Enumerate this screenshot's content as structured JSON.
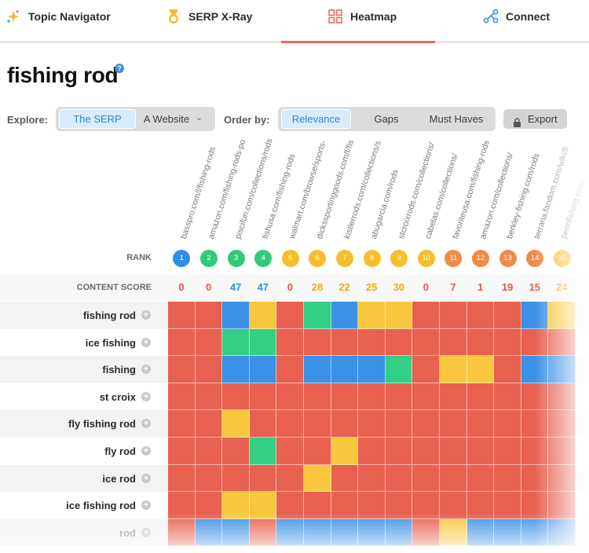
{
  "nav": {
    "tabs": [
      {
        "label": "Topic Navigator",
        "icon": "sparkle-icon"
      },
      {
        "label": "SERP X-Ray",
        "icon": "medal-icon"
      },
      {
        "label": "Heatmap",
        "icon": "grid-icon",
        "active": true
      },
      {
        "label": "Connect",
        "icon": "network-icon"
      }
    ]
  },
  "page": {
    "title": "fishing rod",
    "help_icon": "?"
  },
  "controls": {
    "explore_label": "Explore:",
    "explore_options": [
      "The SERP",
      "A Website"
    ],
    "explore_selected": "The SERP",
    "order_label": "Order by:",
    "order_options": [
      "Relevance",
      "Gaps",
      "Must Haves"
    ],
    "order_selected": "Relevance",
    "export_label": "Export"
  },
  "table": {
    "urls": [
      "basspro.com/l/fishing-rods",
      "amazon.com/fishing-rods-po",
      "piscifun.com/collections/rods",
      "fishusa.com/fishing-rods",
      "walmart.com/browse/sports-",
      "dickssportinggoods.com/f/fis",
      "kistlerrods.com/collections/s",
      "abugarcia.com/rods",
      "stcroixrods.com/collections/",
      "cabelas.com/collections/",
      "favoriteusa.com/fishing-rods",
      "amazon.com/collections/",
      "berkley-fishing.com/rods",
      "terraria.fandom.com/wiki/fi",
      "pennfishing.com"
    ],
    "rank_label": "RANK",
    "ranks": [
      "1",
      "2",
      "3",
      "4",
      "5",
      "6",
      "7",
      "8",
      "9",
      "10",
      "11",
      "12",
      "13",
      "14",
      "15"
    ],
    "rank_colors": [
      "#2e8fe4",
      "#2fca79",
      "#2fca79",
      "#2fca79",
      "#f6be2b",
      "#f6be2b",
      "#f6be2b",
      "#f6be2b",
      "#f6be2b",
      "#f6be2b",
      "#ef8a48",
      "#ef8a48",
      "#ef8a48",
      "#ef8a48",
      "#f6be2b"
    ],
    "score_label": "CONTENT SCORE",
    "scores": [
      "0",
      "0",
      "47",
      "47",
      "0",
      "28",
      "22",
      "25",
      "30",
      "0",
      "7",
      "1",
      "19",
      "15",
      "24"
    ],
    "score_colors": [
      "#e8574a",
      "#e8574a",
      "#2e8fe4",
      "#2e8fe4",
      "#e8574a",
      "#e9ad17",
      "#e9ad17",
      "#e9ad17",
      "#e9ad17",
      "#e8574a",
      "#e8574a",
      "#e8574a",
      "#e8574a",
      "#e8574a",
      "#e9ad17"
    ],
    "keywords": [
      "fishing rod",
      "ice fishing",
      "fishing",
      "st croix",
      "fly fishing rod",
      "fly rod",
      "ice rod",
      "ice fishing rod",
      "rod"
    ],
    "color_key": {
      "r": "#e8604f",
      "b": "#3b91e6",
      "y": "#f8c73d",
      "g": "#33cf85"
    },
    "heatmap": [
      "rrbyrgbyyrrrrby",
      "rrggrrrrrrrrrrr",
      "rrbbrbbbgryyrbb",
      "rrrrrrrrrrrrrrr",
      "rryrrrrrrrrrrrr",
      "rrrgrryrrrrrrrr",
      "rrrrryrrrrrrrrr",
      "rryyrrrrrrrrrrr",
      "rbbrbbbbbrybbbb"
    ]
  }
}
